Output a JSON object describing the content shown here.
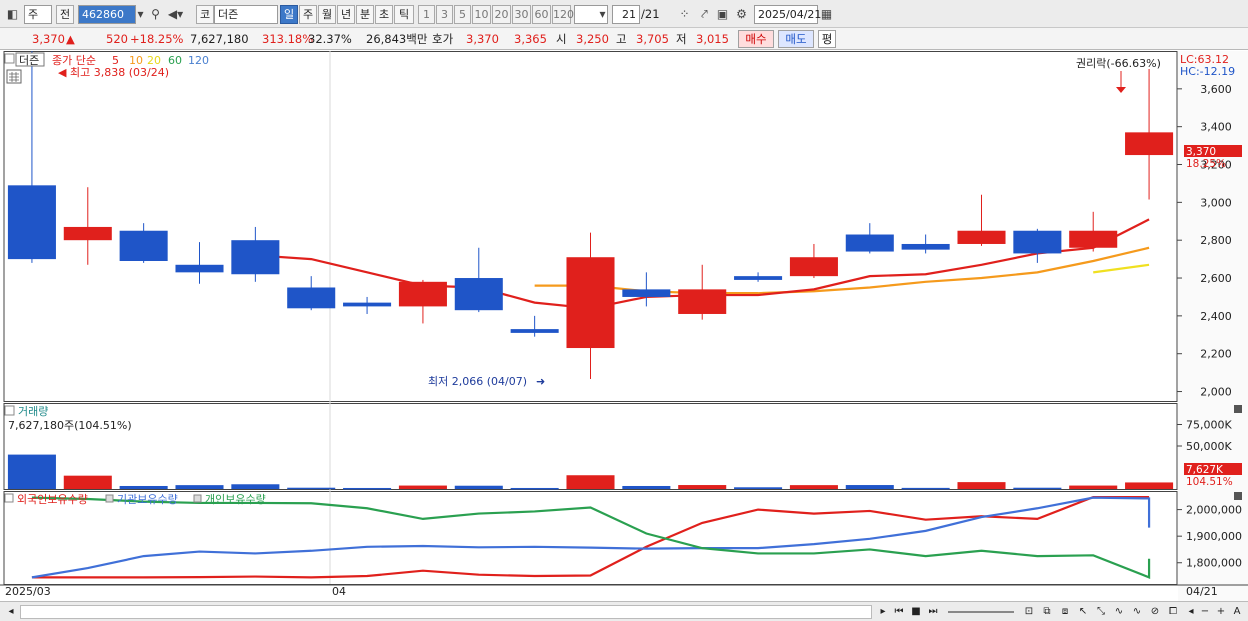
{
  "toolbar": {
    "period_type": "주",
    "prev_label": "전",
    "stock_code": "462860",
    "market_label": "코",
    "stock_name": "더즌",
    "tabs": [
      "일",
      "주",
      "월",
      "년",
      "분",
      "초",
      "틱"
    ],
    "active_tab": "일",
    "intervals": [
      "1",
      "3",
      "5",
      "10",
      "20",
      "30",
      "60",
      "120"
    ],
    "count_value": "21",
    "count_total": "/21",
    "date": "2025/04/21"
  },
  "quote": {
    "price": "3,370",
    "change_arrow": "▲",
    "change": "520",
    "change_pct": "+18.25%",
    "volume": "7,627,180",
    "volume_ratio": "313.18%",
    "turnover": "32.37%",
    "amount": "26,843백만",
    "bid_label": "호가",
    "ask_price": "3,370",
    "bid_price": "3,365",
    "open_label": "시",
    "open": "3,250",
    "high_label": "고",
    "high": "3,705",
    "low_label": "저",
    "low": "3,015",
    "buy_label": "매수",
    "sell_label": "매도",
    "avg_label": "평"
  },
  "price_panel": {
    "stock_name": "더즌",
    "ma_label": "종가 단순",
    "ma_periods": [
      "5",
      "10",
      "20",
      "60",
      "120"
    ],
    "ma_colors": [
      "#e0201c",
      "#f59a1c",
      "#f0e020",
      "#2aa050",
      "#4a80d0"
    ],
    "high_annotation": "최고 3,838 (03/24)",
    "low_annotation": "최저 2,066 (04/07)",
    "rights_annotation": "권리락(-66.63%)",
    "lc_label": "LC:63.12",
    "hc_label": "HC:-12.19",
    "last_price_tag": "3,370",
    "last_pct_tag": "18.25%",
    "y_ticks": [
      "3,600",
      "3,400",
      "3,200",
      "3,000",
      "2,800",
      "2,600",
      "2,400",
      "2,200",
      "2,000"
    ]
  },
  "volume_panel": {
    "title": "거래량",
    "current": "7,627,180주(104.51%)",
    "y_ticks": [
      "75,000K",
      "50,000K"
    ],
    "last_tag": "7,627K",
    "last_pct_tag": "104.51%"
  },
  "holdings_panel": {
    "legend": [
      "외국인보유수량",
      "기관보유수량",
      "개인보유수량"
    ],
    "y_ticks": [
      "2,000,000",
      "1,900,000",
      "1,800,000"
    ]
  },
  "x_axis": {
    "labels": [
      "2025/03",
      "04"
    ],
    "right_label": "04/21"
  },
  "chart_data": {
    "type": "candlestick",
    "up_color": "#e0201c",
    "down_color": "#1f55c8",
    "price_ylim": [
      1950,
      3800
    ],
    "candles": [
      {
        "o": 3090,
        "h": 3838,
        "l": 2680,
        "c": 2700
      },
      {
        "o": 2800,
        "h": 3080,
        "l": 2670,
        "c": 2870
      },
      {
        "o": 2850,
        "h": 2890,
        "l": 2680,
        "c": 2690
      },
      {
        "o": 2670,
        "h": 2790,
        "l": 2570,
        "c": 2630
      },
      {
        "o": 2800,
        "h": 2870,
        "l": 2580,
        "c": 2620
      },
      {
        "o": 2550,
        "h": 2610,
        "l": 2430,
        "c": 2440
      },
      {
        "o": 2470,
        "h": 2500,
        "l": 2410,
        "c": 2450
      },
      {
        "o": 2450,
        "h": 2590,
        "l": 2360,
        "c": 2580
      },
      {
        "o": 2600,
        "h": 2760,
        "l": 2420,
        "c": 2430
      },
      {
        "o": 2330,
        "h": 2400,
        "l": 2290,
        "c": 2310
      },
      {
        "o": 2230,
        "h": 2840,
        "l": 2066,
        "c": 2710
      },
      {
        "o": 2540,
        "h": 2630,
        "l": 2450,
        "c": 2500
      },
      {
        "o": 2410,
        "h": 2670,
        "l": 2380,
        "c": 2540
      },
      {
        "o": 2610,
        "h": 2630,
        "l": 2580,
        "c": 2590
      },
      {
        "o": 2610,
        "h": 2780,
        "l": 2600,
        "c": 2710
      },
      {
        "o": 2830,
        "h": 2890,
        "l": 2730,
        "c": 2740
      },
      {
        "o": 2780,
        "h": 2830,
        "l": 2730,
        "c": 2750
      },
      {
        "o": 2780,
        "h": 3040,
        "l": 2770,
        "c": 2850
      },
      {
        "o": 2850,
        "h": 2860,
        "l": 2680,
        "c": 2730
      },
      {
        "o": 2760,
        "h": 2950,
        "l": 2740,
        "c": 2850
      },
      {
        "o": 3250,
        "h": 3705,
        "l": 3015,
        "c": 3370
      }
    ],
    "ma5": [
      null,
      null,
      null,
      null,
      2720,
      2700,
      2630,
      2560,
      2550,
      2470,
      2440,
      2500,
      2510,
      2510,
      2540,
      2610,
      2620,
      2670,
      2730,
      2760,
      2910
    ],
    "ma10": [
      null,
      null,
      null,
      null,
      null,
      null,
      null,
      null,
      null,
      2560,
      2560,
      2530,
      2520,
      2520,
      2530,
      2550,
      2580,
      2600,
      2630,
      2690,
      2760
    ],
    "ma20": [
      null,
      null,
      null,
      null,
      null,
      null,
      null,
      null,
      null,
      null,
      null,
      null,
      null,
      null,
      null,
      null,
      null,
      null,
      null,
      2630,
      2670
    ],
    "volume": [
      {
        "v": 40000,
        "up": false
      },
      {
        "v": 15500,
        "up": true
      },
      {
        "v": 3500,
        "up": false
      },
      {
        "v": 4500,
        "up": false
      },
      {
        "v": 5500,
        "up": false
      },
      {
        "v": 1500,
        "up": false
      },
      {
        "v": 1200,
        "up": false
      },
      {
        "v": 4000,
        "up": true
      },
      {
        "v": 3800,
        "up": false
      },
      {
        "v": 1200,
        "up": false
      },
      {
        "v": 16000,
        "up": true
      },
      {
        "v": 3500,
        "up": false
      },
      {
        "v": 4600,
        "up": true
      },
      {
        "v": 2000,
        "up": false
      },
      {
        "v": 4500,
        "up": true
      },
      {
        "v": 4600,
        "up": false
      },
      {
        "v": 1300,
        "up": false
      },
      {
        "v": 8000,
        "up": true
      },
      {
        "v": 1500,
        "up": false
      },
      {
        "v": 4000,
        "up": true
      },
      {
        "v": 7627,
        "up": true
      }
    ],
    "volume_ylim": [
      0,
      100000
    ],
    "holdings_ylim": [
      1720000,
      2070000
    ],
    "holdings": [
      {
        "name": "외국인보유수량",
        "color": "#e0201c",
        "values": [
          1745000,
          1745000,
          1745000,
          1746000,
          1748000,
          1745000,
          1750000,
          1770000,
          1755000,
          1750000,
          1752000,
          1860000,
          1950000,
          2000000,
          1985000,
          1995000,
          1962000,
          1975000,
          1965000,
          2047000,
          2047000
        ]
      },
      {
        "name": "기관보유수량",
        "color": "#4070d8",
        "values": [
          1745000,
          1780000,
          1825000,
          1842000,
          1835000,
          1845000,
          1860000,
          1863000,
          1858000,
          1860000,
          1857000,
          1853000,
          1855000,
          1855000,
          1870000,
          1890000,
          1920000,
          1972000,
          2005000,
          2045000,
          2042000,
          1932000
        ]
      },
      {
        "name": "개인보유수량",
        "color": "#2aa050",
        "values": [
          2045000,
          2040000,
          2030000,
          2025000,
          2025000,
          2024000,
          2005000,
          1965000,
          1985000,
          1993000,
          2008000,
          1910000,
          1855000,
          1835000,
          1835000,
          1850000,
          1825000,
          1845000,
          1825000,
          1828000,
          1745000,
          1815000
        ]
      }
    ]
  }
}
